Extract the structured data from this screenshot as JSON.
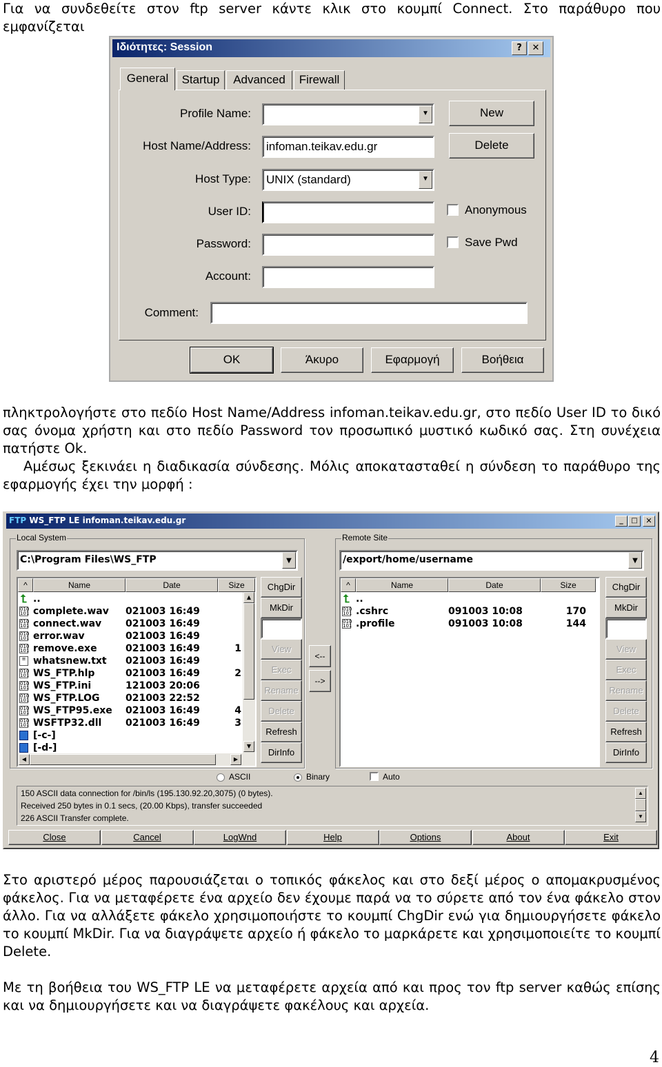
{
  "text": {
    "intro": "Για να συνδεθείτε στον ftp server κάντε κλικ στο κουμπί Connect. Στο παράθυρο που εμφανίζεται",
    "para2": "πληκτρολογήστε στο πεδίο Host Name/Address  infoman.teikav.edu.gr,  στο πεδίο User ID το δικό σας όνομα χρήστη και στο πεδίο Password τον προσωπικό μυστικό κωδικό σας. Στη συνέχεια πατήστε Ok.",
    "para3": "Αμέσως ξεκινάει η διαδικασία σύνδεσης. Μόλις αποκατασταθεί η σύνδεση το παράθυρο της εφαρμογής έχει την μορφή :",
    "para4": "Στο αριστερό μέρος παρουσιάζεται ο τοπικός φάκελος και στο δεξί μέρος ο απομακρυσμένος φάκελος. Για να μεταφέρετε ένα αρχείο δεν έχουμε παρά να το σύρετε από τον ένα φάκελο στον άλλο. Για να αλλάξετε φάκελο χρησιμοποιήστε το κουμπί ChgDir ενώ για δημιουργήσετε φάκελο το κουμπί MkDir. Για να διαγράψετε αρχείο ή φάκελο το μαρκάρετε και χρησιμοποιείτε το κουμπί Delete.",
    "para5": "Με τη βοήθεια του WS_FTP LE να μεταφέρετε αρχεία από και προς τον ftp server καθώς επίσης και να δημιουργήσετε και να διαγράψετε φακέλους και αρχεία.",
    "page_number": "4"
  },
  "session_dialog": {
    "title": "Ιδιότητες: Session",
    "help_btn": "?",
    "close_btn": "✕",
    "tabs": [
      "General",
      "Startup",
      "Advanced",
      "Firewall"
    ],
    "labels": {
      "profile": "Profile Name:",
      "host": "Host Name/Address:",
      "host_type": "Host Type:",
      "user": "User ID:",
      "password": "Password:",
      "account": "Account:",
      "comment": "Comment:"
    },
    "values": {
      "profile": "",
      "host": "infoman.teikav.edu.gr",
      "host_type": "UNIX (standard)",
      "user": "",
      "password": "",
      "account": "",
      "comment": ""
    },
    "new_btn": "New",
    "delete_btn": "Delete",
    "anonymous": "Anonymous",
    "save_pwd": "Save Pwd",
    "ok": "OK",
    "cancel": "Άκυρο",
    "apply": "Εφαρμογή",
    "help": "Βοήθεια"
  },
  "wsftp": {
    "title": "WS_FTP LE infoman.teikav.edu.gr",
    "logo": "FTP",
    "local": {
      "label": "Local System",
      "path": "C:\\Program Files\\WS_FTP",
      "columns": [
        "^",
        "Name",
        "Date",
        "Size"
      ],
      "rows": [
        {
          "icon": "up",
          "name": "..",
          "date": "",
          "size": ""
        },
        {
          "icon": "file",
          "name": "complete.wav",
          "date": "021003 16:49",
          "size": ""
        },
        {
          "icon": "file",
          "name": "connect.wav",
          "date": "021003 16:49",
          "size": ""
        },
        {
          "icon": "file",
          "name": "error.wav",
          "date": "021003 16:49",
          "size": ""
        },
        {
          "icon": "file",
          "name": "remove.exe",
          "date": "021003 16:49",
          "size": "1"
        },
        {
          "icon": "text",
          "name": "whatsnew.txt",
          "date": "021003 16:49",
          "size": ""
        },
        {
          "icon": "file",
          "name": "WS_FTP.hlp",
          "date": "021003 16:49",
          "size": "2"
        },
        {
          "icon": "file",
          "name": "WS_FTP.ini",
          "date": "121003 20:06",
          "size": ""
        },
        {
          "icon": "file",
          "name": "WS_FTP.LOG",
          "date": "021003 22:52",
          "size": ""
        },
        {
          "icon": "file",
          "name": "WS_FTP95.exe",
          "date": "021003 16:49",
          "size": "4"
        },
        {
          "icon": "file",
          "name": "WSFTP32.dll",
          "date": "021003 16:49",
          "size": "3"
        },
        {
          "icon": "drive",
          "name": "[-c-]",
          "date": "",
          "size": ""
        },
        {
          "icon": "drive",
          "name": "[-d-]",
          "date": "",
          "size": ""
        }
      ]
    },
    "remote": {
      "label": "Remote Site",
      "path": "/export/home/username",
      "columns": [
        "^",
        "Name",
        "Date",
        "Size"
      ],
      "rows": [
        {
          "icon": "up",
          "name": "..",
          "date": "",
          "size": ""
        },
        {
          "icon": "file",
          "name": ".cshrc",
          "date": "091003 10:08",
          "size": "170"
        },
        {
          "icon": "file",
          "name": ".profile",
          "date": "091003 10:08",
          "size": "144"
        }
      ]
    },
    "side_buttons": [
      "ChgDir",
      "MkDir",
      "View",
      "Exec",
      "Rename",
      "Delete",
      "Refresh",
      "DirInfo"
    ],
    "arrow_left": "<--",
    "arrow_right": "-->",
    "mode": {
      "ascii": "ASCII",
      "binary": "Binary",
      "auto": "Auto",
      "selected": "Binary",
      "auto_checked": false
    },
    "log": [
      "150 ASCII data connection for /bin/ls (195.130.92.20,3075) (0 bytes).",
      "Received 250 bytes in 0.1 secs, (20.00 Kbps), transfer succeeded",
      "226 ASCII Transfer complete."
    ],
    "bottom_buttons": [
      "Close",
      "Cancel",
      "LogWnd",
      "Help",
      "Options",
      "About",
      "Exit"
    ]
  }
}
